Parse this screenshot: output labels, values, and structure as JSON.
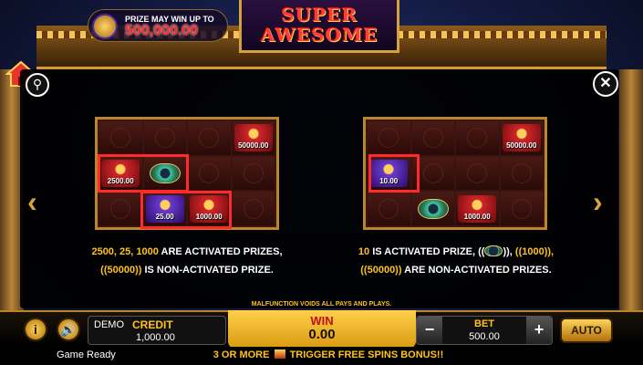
{
  "header": {
    "prize_line1": "PRIZE MAY WIN UP TO",
    "prize_amount": "500,000.00",
    "logo_word1": "SUPER",
    "logo_word2": "AWESOME"
  },
  "help_panel": {
    "example1": {
      "prizes": [
        "2500.00",
        "25.00",
        "1000.00",
        "50000.00"
      ],
      "line1_values": "2500, 25, 1000",
      "line1_text": " ARE ACTIVATED PRIZES,",
      "line2_values": "((50000))",
      "line2_text": " IS NON-ACTIVATED PRIZE."
    },
    "example2": {
      "prizes": [
        "10.00",
        "1000.00",
        "50000.00"
      ],
      "line1_values": "10",
      "line1_text": " IS ACTIVATED PRIZE, ((",
      "line1_tail": ")), ",
      "line1_value2": "((1000)),",
      "line2_values": "((50000))",
      "line2_text": " ARE NON-ACTIVATED PRIZES."
    },
    "disclaimer": "MALFUNCTION VOIDS ALL PAYS AND PLAYS."
  },
  "controls": {
    "info_icon_label": "i",
    "demo_label": "DEMO",
    "credit_label": "CREDIT",
    "credit_value": "1,000.00",
    "win_label": "WIN",
    "win_value": "0.00",
    "bet_label": "BET",
    "bet_value": "500.00",
    "bet_minus": "−",
    "bet_plus": "+",
    "auto_label": "AUTO"
  },
  "status": {
    "game_state": "Game Ready",
    "ticker_pre": "3 OR MORE",
    "ticker_post": "TRIGGER FREE SPINS BONUS!!"
  },
  "icons": [
    "home-icon",
    "search-icon",
    "close-icon",
    "chevron-left-icon",
    "chevron-right-icon",
    "info-icon",
    "speaker-icon"
  ],
  "colors": {
    "accent_gold": "#ffc21a",
    "highlight_red": "#ff2a2a",
    "panel_bg": "#000000"
  }
}
